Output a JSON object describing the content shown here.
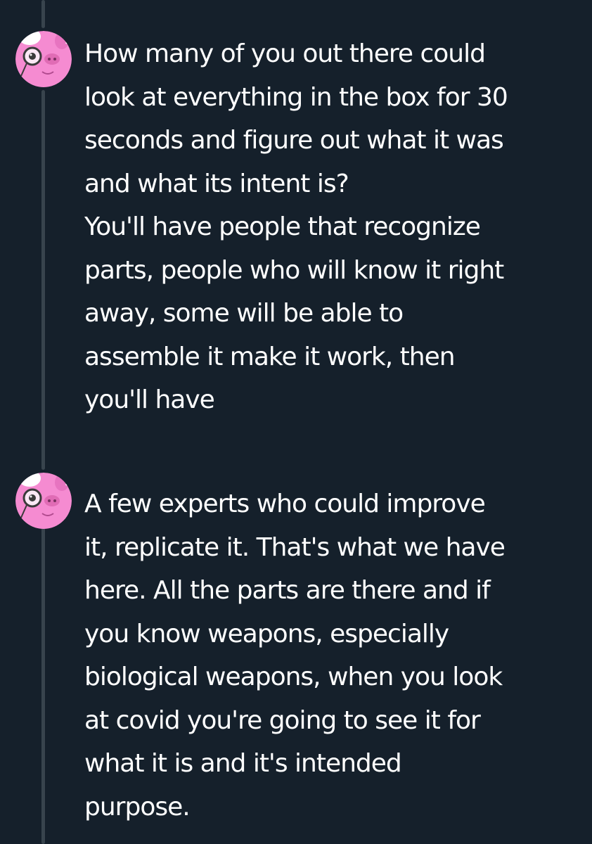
{
  "theme": {
    "background": "#15202b",
    "thread_line_color": "#38444d",
    "text_color": "#ffffff",
    "avatar_color": "#f58bd1"
  },
  "thread": {
    "tweets": [
      {
        "avatar_icon": "pink-pig-monocle-avatar",
        "lines": [
          "How many of you out there could",
          "look at everything in the box for 30",
          "seconds and figure out what it was",
          "and what its intent is?",
          "You'll have people that recognize",
          "parts, people who will know it right",
          "away, some will be able to",
          "assemble it make it work, then",
          "you'll have"
        ]
      },
      {
        "avatar_icon": "pink-pig-monocle-avatar",
        "lines": [
          "A few experts who could improve",
          "it, replicate it. That's what we have",
          "here. All the parts are there and if",
          "you know weapons, especially",
          "biological weapons, when you look",
          "at covid you're going to see it for",
          "what it is and it's intended",
          "purpose."
        ]
      }
    ]
  }
}
